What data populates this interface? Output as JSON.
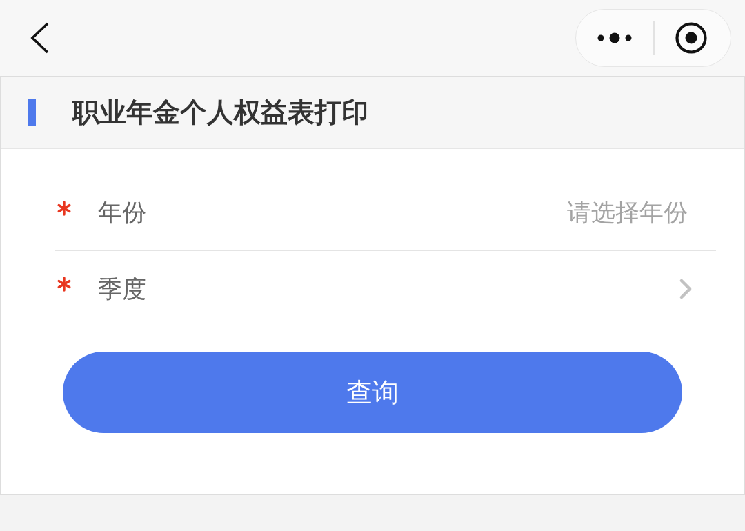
{
  "header": {
    "title": "职业年金个人权益表打印"
  },
  "form": {
    "fields": [
      {
        "kind": "placeholder",
        "label": "年份",
        "required": true,
        "placeholder": "请选择年份"
      },
      {
        "kind": "chevron",
        "label": "季度",
        "required": true
      }
    ]
  },
  "buttons": [
    "查询"
  ]
}
